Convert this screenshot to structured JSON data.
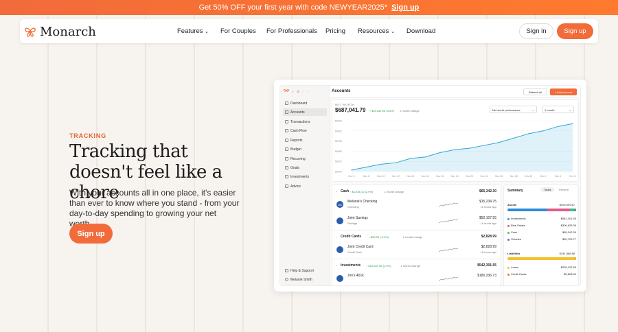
{
  "promo": {
    "text": "Get 50% OFF your first year with code NEWYEAR2025*",
    "link": "Sign up"
  },
  "nav": {
    "brand": "Monarch",
    "links": [
      "Features",
      "For Couples",
      "For Professionals",
      "Pricing",
      "Resources",
      "Download"
    ],
    "sign_in": "Sign in",
    "sign_up": "Sign up"
  },
  "hero": {
    "eyebrow": "TRACKING",
    "headline": "Tracking that doesn't feel like a chore",
    "body": "With your accounts all in one place, it's easier than ever to know where you stand - from your day-to-day spending to growing your net worth.",
    "cta": "Sign up"
  },
  "app": {
    "sidebar": [
      "Dashboard",
      "Accounts",
      "Transactions",
      "Cash Flow",
      "Reports",
      "Budget",
      "Recurring",
      "Goals",
      "Investments",
      "Advice"
    ],
    "sidebar_footer": [
      "Help & Support",
      "Melanie Smith"
    ],
    "title": "Accounts",
    "refresh": "Refresh all",
    "add": "+ Add account",
    "net_worth_label": "NET WORTH",
    "net_worth": "$687,041.79",
    "net_change": "↑ $23,542.96 (3.5%)",
    "net_change_period": "1 month change",
    "perf_select": "Net worth performance",
    "period_select": "1 month",
    "y_ticks": [
      "$689K",
      "$682K",
      "$675K",
      "$668K",
      "$661K",
      "$654K"
    ],
    "x_ticks": [
      "Nov 6",
      "Nov 8",
      "Nov 10",
      "Nov 12",
      "Nov 14",
      "Nov 16",
      "Nov 18",
      "Nov 20",
      "Nov 22",
      "Nov 24",
      "Nov 26",
      "Nov 28",
      "Nov 30",
      "Dec 2",
      "Dec 4",
      "Dec 6"
    ],
    "groups": [
      {
        "name": "Cash",
        "change": "↑ $1,826.10 (2.9%)",
        "period": "1 month change",
        "total": "$65,342.30",
        "accounts": [
          {
            "name": "Melanie's Checking",
            "type": "Checking",
            "value": "$15,234.75",
            "ago": "16 hours ago",
            "badge": "DB"
          },
          {
            "name": "Joint Savings",
            "type": "Savings",
            "value": "$50,107.55",
            "ago": "16 hours ago",
            "badge": ""
          }
        ]
      },
      {
        "name": "Credit Cards",
        "change": "↓ $63.09 (-2.2%)",
        "period": "1 month change",
        "total": "$2,828.99",
        "accounts": [
          {
            "name": "Joint Credit Card",
            "type": "Credit Card",
            "value": "$2,828.99",
            "ago": "16 hours ago",
            "badge": ""
          }
        ]
      },
      {
        "name": "Investments",
        "change": "↑ $10,287.56 (1.9%)",
        "period": "1 month change",
        "total": "$542,301.55",
        "accounts": [
          {
            "name": "Jon's 401k",
            "type": "",
            "value": "$180,336.73",
            "ago": "",
            "badge": ""
          }
        ]
      }
    ],
    "summary": {
      "title": "Summary",
      "tabs": [
        "Totals",
        "Percent"
      ],
      "assets_label": "Assets",
      "assets_total": "$929,009.67",
      "assets": [
        {
          "name": "Investments",
          "value": "$542,301.55",
          "color": "#2e8bd8"
        },
        {
          "name": "Real Estate",
          "value": "$300,625.05",
          "color": "#e05a8a"
        },
        {
          "name": "Cash",
          "value": "$65,342.30",
          "color": "#3cbf7a"
        },
        {
          "name": "Vehicles",
          "value": "$20,729.77",
          "color": "#7a5cd8"
        }
      ],
      "liabilities_label": "Liabilities",
      "liabilities_total": "$241,966.88",
      "liabilities": [
        {
          "name": "Loans",
          "value": "$239,137.89",
          "color": "#f2c230"
        },
        {
          "name": "Credit Cards",
          "value": "$2,828.99",
          "color": "#f26b3a"
        }
      ]
    }
  },
  "colors": {
    "accent": "#f26b3a",
    "chart": "#2ea6d6",
    "background": "#f7f3ef"
  },
  "chart_data": {
    "type": "area",
    "x": [
      "Nov 6",
      "Nov 8",
      "Nov 10",
      "Nov 12",
      "Nov 14",
      "Nov 16",
      "Nov 18",
      "Nov 20",
      "Nov 22",
      "Nov 24",
      "Nov 26",
      "Nov 28",
      "Nov 30",
      "Dec 2",
      "Dec 4",
      "Dec 6"
    ],
    "values": [
      655,
      657,
      659,
      660,
      663,
      664,
      667,
      669,
      670,
      672,
      674,
      677,
      680,
      682,
      685,
      687
    ],
    "ylim": [
      654,
      689
    ],
    "xlabel": "",
    "ylabel": "",
    "title": ""
  }
}
